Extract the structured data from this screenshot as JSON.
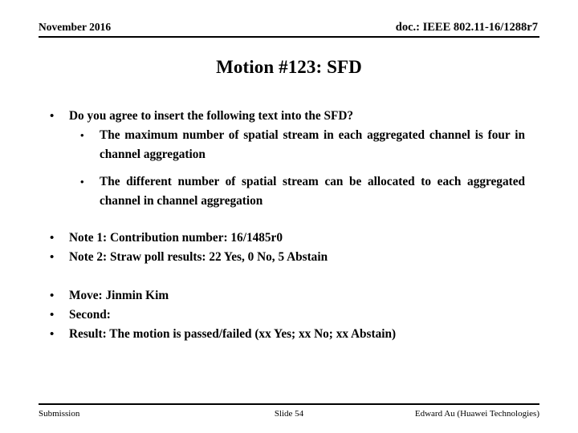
{
  "header": {
    "date": "November 2016",
    "doc_number": "doc.: IEEE 802.11-16/1288r7"
  },
  "title": "Motion #123:  SFD",
  "body": {
    "question": "Do you agree to insert the following text into the SFD?",
    "sub_bullets": [
      "The maximum number of spatial stream in each aggregated channel is four in channel aggregation",
      "The different number of spatial stream can be allocated to each aggregated channel in channel aggregation"
    ],
    "notes": [
      "Note 1:  Contribution number:  16/1485r0",
      "Note 2:  Straw poll results:  22 Yes, 0 No, 5 Abstain"
    ],
    "actions": [
      "Move:  Jinmin Kim",
      "Second:",
      "Result:  The motion is passed/failed (xx Yes; xx No; xx Abstain)"
    ]
  },
  "footer": {
    "left": "Submission",
    "center": "Slide 54",
    "right": "Edward Au (Huawei Technologies)"
  },
  "bullet_glyph": "•"
}
